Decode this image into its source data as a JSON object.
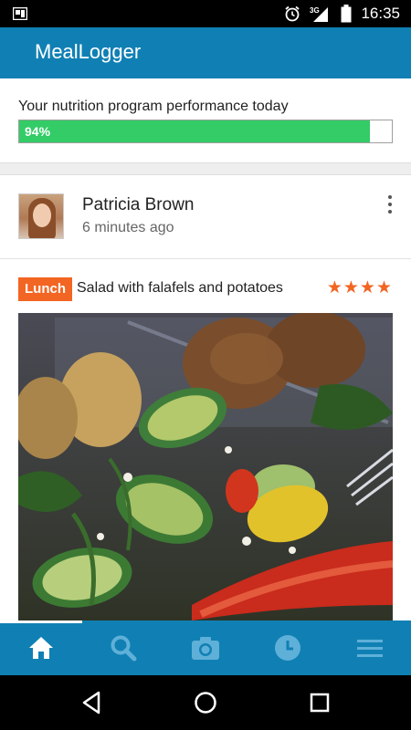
{
  "status_bar": {
    "time": "16:35",
    "network": "3G",
    "icons": [
      "photo-notification-icon",
      "alarm-icon",
      "signal-icon",
      "battery-icon"
    ]
  },
  "app": {
    "title": "MealLogger",
    "brand_color": "#1080b4"
  },
  "nutrition": {
    "label": "Your nutrition program performance today",
    "progress_text": "94%",
    "progress_value": 0.94,
    "bar_color": "#33cc66"
  },
  "post": {
    "author": "Patricia Brown",
    "time": "6 minutes ago",
    "meal_type": "Lunch",
    "meal_type_color": "#f26522",
    "meal_title": "Salad with falafels and potatoes",
    "rating": 4,
    "rating_stars": "★★★★"
  },
  "bottom_nav": {
    "items": [
      {
        "icon": "home-icon",
        "active": true
      },
      {
        "icon": "search-icon",
        "active": false
      },
      {
        "icon": "camera-icon",
        "active": false
      },
      {
        "icon": "history-clock-icon",
        "active": false
      },
      {
        "icon": "menu-icon",
        "active": false
      }
    ]
  },
  "system_nav": {
    "icons": [
      "back-icon",
      "home-circle-icon",
      "recents-icon"
    ]
  }
}
